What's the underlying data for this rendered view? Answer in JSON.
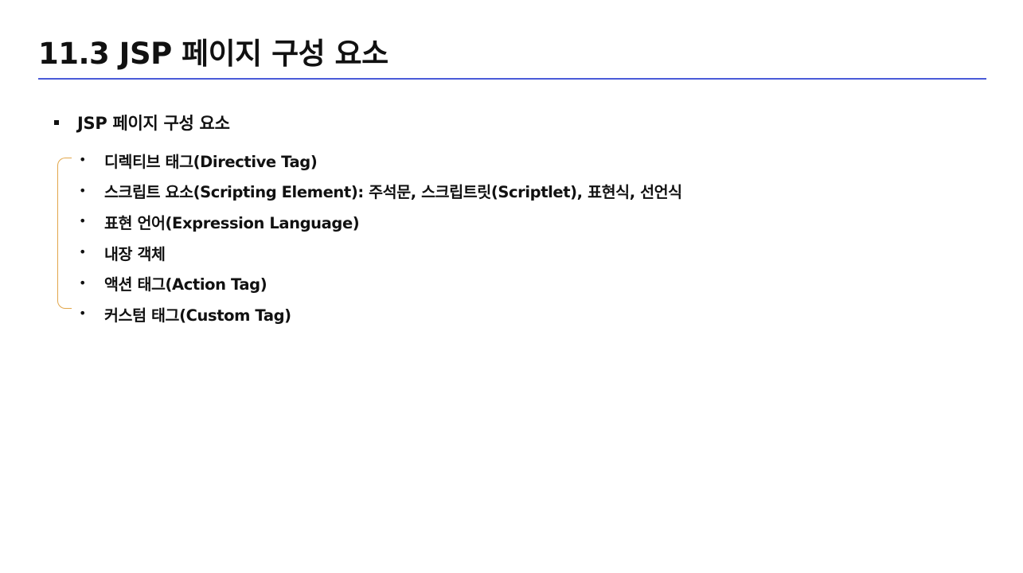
{
  "slide": {
    "title": "11.3 JSP 페이지 구성 요소",
    "rule_color": "#4a5ad8",
    "bracket_color": "#e2a64a"
  },
  "section": {
    "label": "JSP 페이지 구성 요소"
  },
  "items": [
    "디렉티브 태그(Directive Tag)",
    "스크립트 요소(Scripting Element): 주석문, 스크립트릿(Scriptlet), 표현식, 선언식",
    "표현 언어(Expression Language)",
    "내장 객체",
    "액션 태그(Action Tag)",
    "커스텀 태그(Custom Tag)"
  ]
}
